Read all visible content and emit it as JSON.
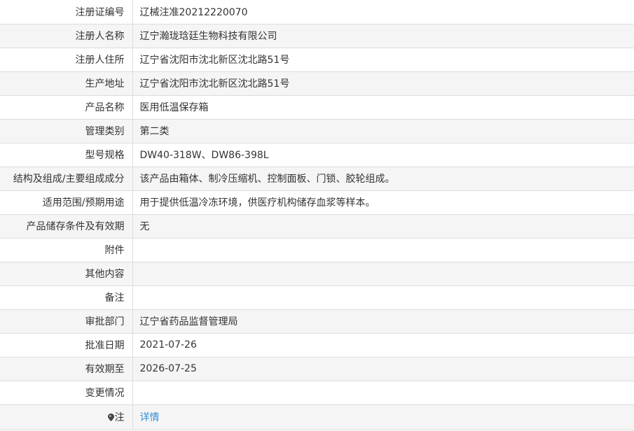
{
  "rows": [
    {
      "label": "注册证编号",
      "value": "辽械注准20212220070"
    },
    {
      "label": "注册人名称",
      "value": "辽宁瀚珑琀廷生物科技有限公司"
    },
    {
      "label": "注册人住所",
      "value": "辽宁省沈阳市沈北新区沈北路51号"
    },
    {
      "label": "生产地址",
      "value": "辽宁省沈阳市沈北新区沈北路51号"
    },
    {
      "label": "产品名称",
      "value": "医用低温保存箱"
    },
    {
      "label": "管理类别",
      "value": "第二类"
    },
    {
      "label": "型号规格",
      "value": "DW40-318W、DW86-398L"
    },
    {
      "label": "结构及组成/主要组成成分",
      "value": "该产品由箱体、制冷压缩机、控制面板、门锁、胶轮组成。"
    },
    {
      "label": "适用范围/预期用途",
      "value": "用于提供低温冷冻环境，供医疗机构储存血浆等样本。"
    },
    {
      "label": "产品储存条件及有效期",
      "value": "无"
    },
    {
      "label": "附件",
      "value": ""
    },
    {
      "label": "其他内容",
      "value": ""
    },
    {
      "label": "备注",
      "value": ""
    },
    {
      "label": "审批部门",
      "value": "辽宁省药品监督管理局"
    },
    {
      "label": "批准日期",
      "value": "2021-07-26"
    },
    {
      "label": "有效期至",
      "value": "2026-07-25"
    },
    {
      "label": "变更情况",
      "value": ""
    }
  ],
  "note_row": {
    "icon": "pin-icon",
    "label": "注",
    "link_text": "详情"
  }
}
